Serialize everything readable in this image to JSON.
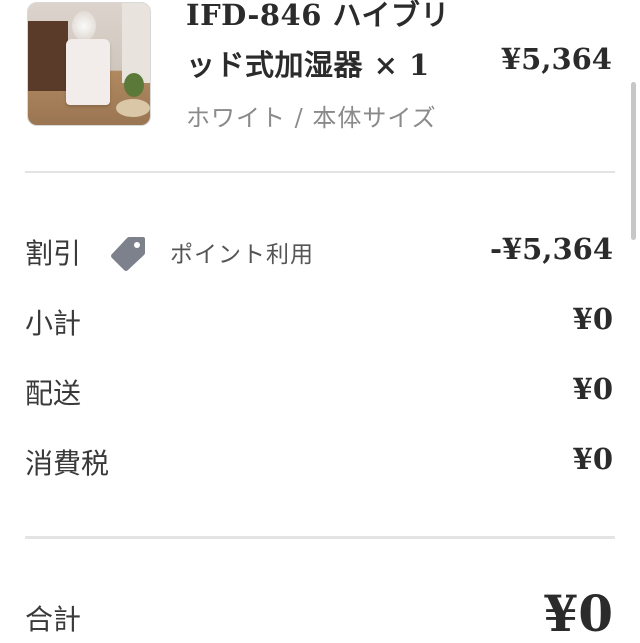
{
  "product": {
    "title": "IFD-846 ハイブリッド式加湿器 × 1",
    "price": "¥5,364",
    "variant": "ホワイト / 本体サイズ",
    "image": "humidifier-product-photo"
  },
  "summary": {
    "discount": {
      "label": "割引",
      "code": "ポイント利用",
      "value": "-¥5,364",
      "icon": "tag-icon"
    },
    "subtotal": {
      "label": "小計",
      "value": "¥0"
    },
    "shipping": {
      "label": "配送",
      "value": "¥0"
    },
    "tax": {
      "label": "消費税",
      "value": "¥0"
    },
    "total": {
      "label": "合計",
      "value": "¥0"
    }
  },
  "colors": {
    "text": "#2b2b2b",
    "muted": "#8a8a8a",
    "divider": "#e3e3e3",
    "tag": "#7d818c"
  }
}
